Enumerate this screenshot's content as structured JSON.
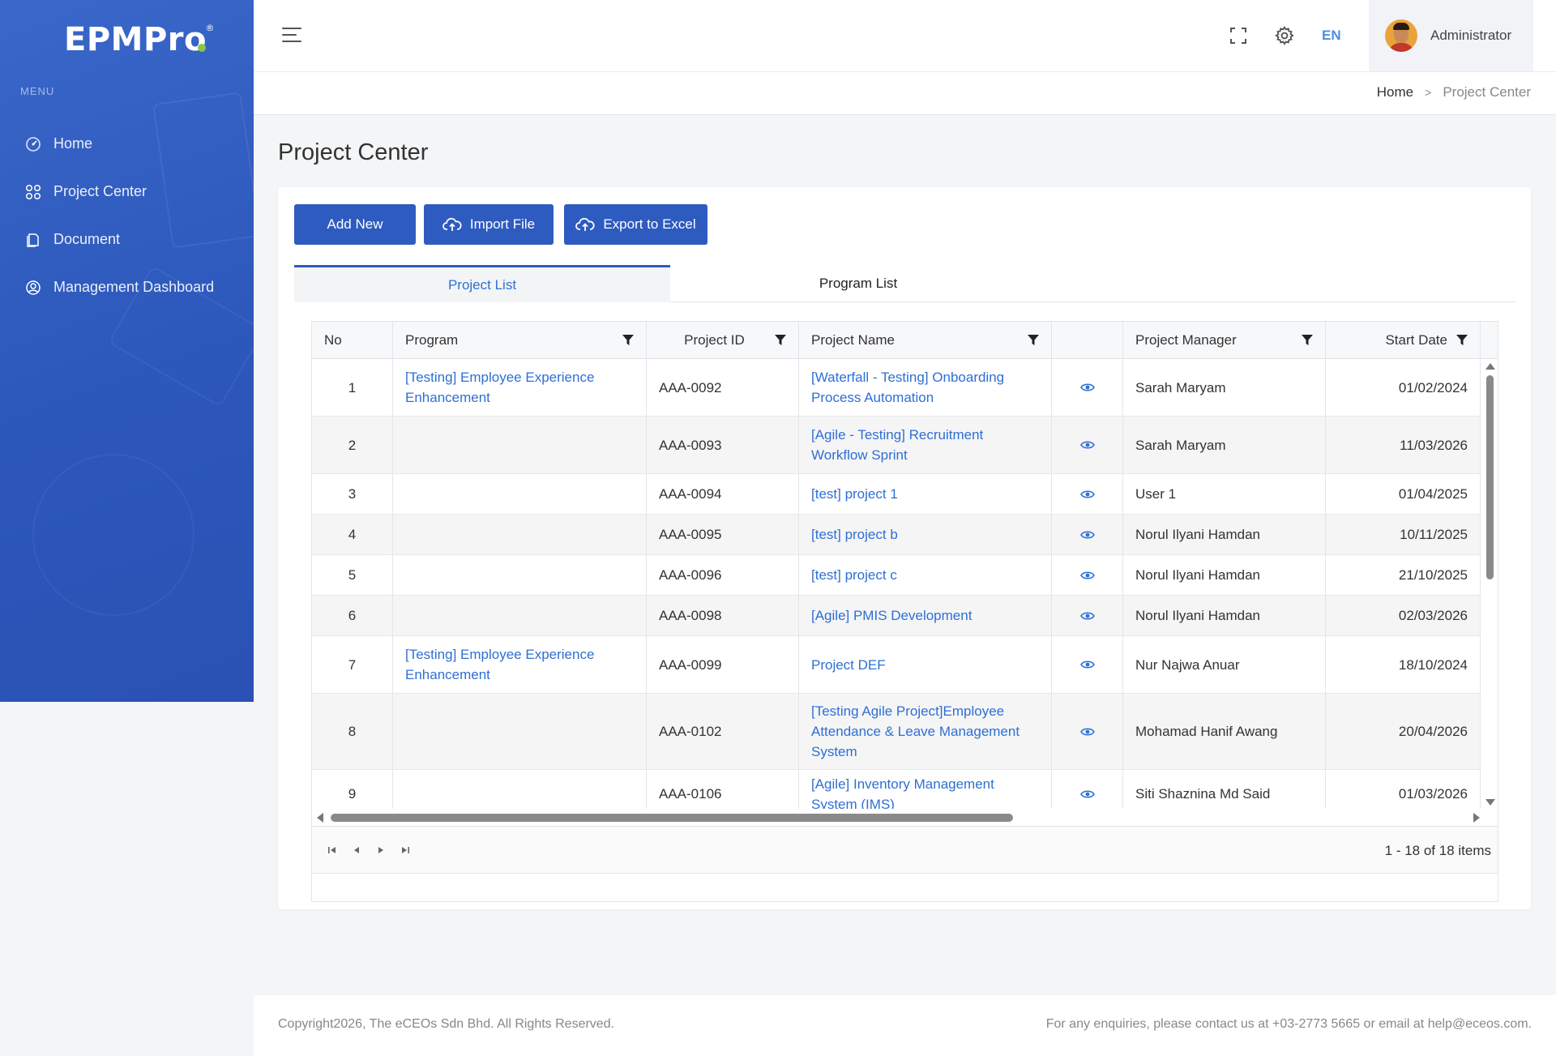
{
  "brand": {
    "name_main": "EPMPr",
    "name_o": "o",
    "reg": "®"
  },
  "sidebar": {
    "menu_label": "MENU",
    "items": [
      {
        "label": "Home",
        "icon": "gauge-icon"
      },
      {
        "label": "Project Center",
        "icon": "grid-icon"
      },
      {
        "label": "Document",
        "icon": "document-icon"
      },
      {
        "label": "Management Dashboard",
        "icon": "user-circle-icon"
      }
    ]
  },
  "topbar": {
    "lang": "EN",
    "user_name": "Administrator"
  },
  "breadcrumb": {
    "home": "Home",
    "separator": ">",
    "current": "Project Center"
  },
  "page": {
    "title": "Project Center"
  },
  "toolbar": {
    "add_new": "Add New",
    "import_file": "Import File",
    "export_excel": "Export to Excel"
  },
  "tabs": {
    "project_list": "Project List",
    "program_list": "Program List"
  },
  "grid": {
    "columns": [
      "No",
      "Program",
      "Project ID",
      "Project Name",
      "",
      "Project Manager",
      "Start Date"
    ],
    "rows": [
      {
        "no": "1",
        "program": "[Testing] Employee Experience Enhancement",
        "id": "AAA-0092",
        "name": "[Waterfall - Testing] Onboarding Process Automation",
        "manager": "Sarah Maryam",
        "start": "01/02/2024"
      },
      {
        "no": "2",
        "program": "",
        "id": "AAA-0093",
        "name": "[Agile - Testing] Recruitment Workflow Sprint",
        "manager": "Sarah Maryam",
        "start": "11/03/2026"
      },
      {
        "no": "3",
        "program": "",
        "id": "AAA-0094",
        "name": "[test] project 1",
        "manager": "User 1",
        "start": "01/04/2025"
      },
      {
        "no": "4",
        "program": "",
        "id": "AAA-0095",
        "name": "[test] project b",
        "manager": "Norul Ilyani Hamdan",
        "start": "10/11/2025"
      },
      {
        "no": "5",
        "program": "",
        "id": "AAA-0096",
        "name": "[test] project c",
        "manager": "Norul Ilyani Hamdan",
        "start": "21/10/2025"
      },
      {
        "no": "6",
        "program": "",
        "id": "AAA-0098",
        "name": "[Agile] PMIS Development",
        "manager": "Norul Ilyani Hamdan",
        "start": "02/03/2026"
      },
      {
        "no": "7",
        "program": "[Testing] Employee Experience Enhancement",
        "id": "AAA-0099",
        "name": "Project DEF",
        "manager": "Nur Najwa Anuar",
        "start": "18/10/2024"
      },
      {
        "no": "8",
        "program": "",
        "id": "AAA-0102",
        "name": "[Testing Agile Project]Employee Attendance & Leave Management System",
        "manager": "Mohamad Hanif Awang",
        "start": "20/04/2026"
      },
      {
        "no": "9",
        "program": "",
        "id": "AAA-0106",
        "name": "[Agile] Inventory Management System (IMS)",
        "manager": "Siti Shaznina Md Said",
        "start": "01/03/2026"
      }
    ],
    "pager_info": "1 - 18 of 18 items"
  },
  "footer": {
    "copyright": "Copyright2026, The eCEOs Sdn Bhd. All Rights Reserved.",
    "contact": "For any enquiries, please contact us at +03-2773 5665 or email at help@eceos.com."
  },
  "colors": {
    "primary": "#2e5bbf",
    "link": "#2e6fd4",
    "lang": "#4a8fe0"
  }
}
